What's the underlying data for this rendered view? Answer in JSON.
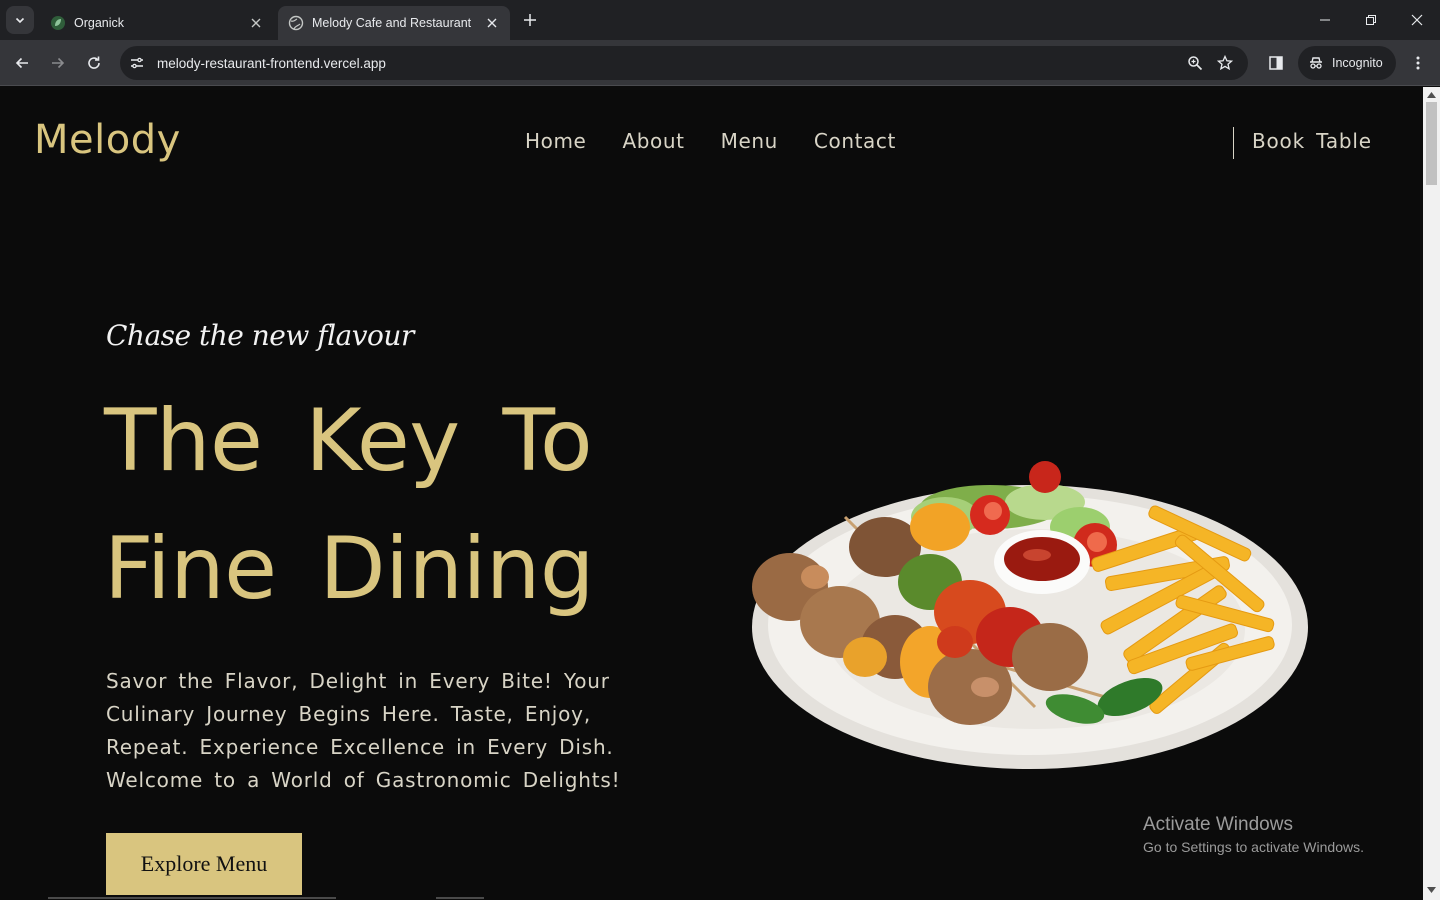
{
  "browser": {
    "tabs": [
      {
        "title": "Organick",
        "active": false,
        "icon": "leaf-favicon-icon"
      },
      {
        "title": "Melody Cafe and Restaurant",
        "active": true,
        "icon": "globe-favicon-icon"
      }
    ],
    "url": "melody-restaurant-frontend.vercel.app",
    "profile_label": "Incognito"
  },
  "site": {
    "logo": "Melody",
    "nav": [
      "Home",
      "About",
      "Menu",
      "Contact"
    ],
    "book_label": "Book Table"
  },
  "hero": {
    "tagline": "Chase the new flavour",
    "headline_line1": "The Key To",
    "headline_line2": "Fine Dining",
    "description": "Savor the Flavor, Delight in Every Bite! Your Culinary Journey Begins Here. Taste, Enjoy, Repeat. Experience Excellence in Every Dish. Welcome to a World of Gastronomic Delights!",
    "cta": "Explore Menu",
    "image_subject": "plate of grilled kebab skewers with fries, salad and ketchup"
  },
  "watermark": {
    "title": "Activate Windows",
    "subtitle": "Go to Settings to activate Windows."
  },
  "colors": {
    "accent": "#d9c57f",
    "background": "#0b0b0b",
    "nav_text": "#d8d4c6"
  }
}
